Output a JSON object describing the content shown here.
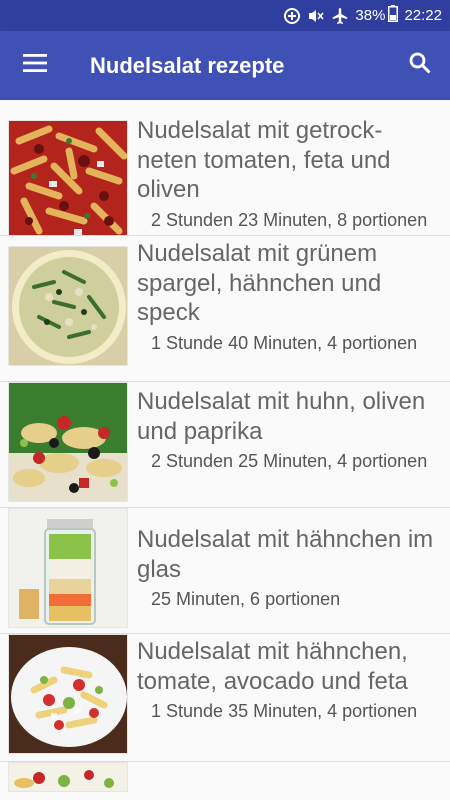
{
  "status_bar": {
    "battery": "38%",
    "time": "22:22"
  },
  "app_bar": {
    "title": "Nudelsalat rezepte",
    "menu_icon": "hamburger-menu-icon",
    "search_icon": "search-icon"
  },
  "recipes": [
    {
      "title": "Nudelsalat mit getrock-\nneten tomaten, feta und oliven",
      "meta": "2 Stunden 23 Minuten, 8 portionen"
    },
    {
      "title": "Nudelsalat mit grünem spargel, hähnchen und speck",
      "meta": "1 Stunde 40 Minuten, 4 portionen"
    },
    {
      "title": "Nudelsalat mit huhn, oliven und paprika",
      "meta": "2 Stunden 25 Minuten, 4 portionen"
    },
    {
      "title": "Nudelsalat mit hähnchen im glas",
      "meta": "25 Minuten, 6 portionen"
    },
    {
      "title": "Nudelsalat mit hähnchen, tomate, avocado und feta",
      "meta": "1 Stunde 35 Minuten, 4 portionen"
    }
  ],
  "colors": {
    "primary": "#3f51b5",
    "primary_dark": "#303f9f",
    "text": "#666666"
  }
}
